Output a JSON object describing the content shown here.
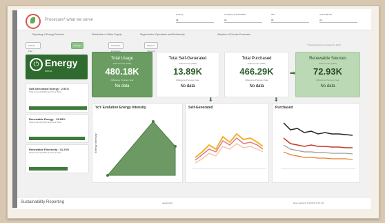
{
  "tagline": "Prosecure* what we serve",
  "filters": [
    {
      "label": "Country",
      "value": "All"
    },
    {
      "label": "Company & Asset Base",
      "value": "All"
    },
    {
      "label": "Site",
      "value": "All"
    },
    {
      "label": "Year & Month",
      "value": "All"
    }
  ],
  "nav_tabs": [
    "Reporting of Energy Emission",
    "Distribution of Water Supply",
    "Regeneration Operations and Biodiversity",
    "Adoption of Circular Processes"
  ],
  "buttons": [
    "CO2 & Fuel Emissions",
    "Energy",
    "GT Power Emissions",
    "Scope 3 Inventory Tool"
  ],
  "hint": "* Selected figures compared to 2020",
  "energy": {
    "title": "Energy",
    "subtitle": "KWh 01"
  },
  "side_cards": [
    {
      "title": "Self-Generated Energy · 2.91%",
      "sub": "Total Amount (KWh) and % of Total",
      "bar_fill": 0.92
    },
    {
      "title": "Renewable Energy · 15.18%",
      "sub": "Total Amount (KWh) and % of Total",
      "bar_fill": 0.88
    },
    {
      "title": "Renewable Electricity · 41.23%",
      "sub": "Total Amount (KWh) and % of Total",
      "bar_fill": 0.6
    }
  ],
  "kpis": [
    {
      "title": "Total Usage",
      "sub": "Total Amount (KWh)",
      "value": "480.18K",
      "note": "Difference Previous Year",
      "delta": "No data"
    },
    {
      "title": "Total Self-Generated",
      "sub": "Total Amount (KWh)",
      "value": "13.89K",
      "note": "Difference Previous Year",
      "delta": "No data"
    },
    {
      "title": "Total Purchased",
      "sub": "Total Amount (KWh)",
      "value": "466.29K",
      "note": "Difference Previous Year",
      "delta": "No data"
    },
    {
      "title": "Renewable Sources",
      "sub": "Total Amount (KWh)",
      "value": "72.93K",
      "note": "Difference Previous Year",
      "delta": "No data"
    }
  ],
  "charts": {
    "evolution": {
      "title": "YoY Evolution Energy Intensity",
      "ylabel": "Energy Intensity"
    },
    "self_generated": {
      "title": "Self-Generated"
    },
    "purchased": {
      "title": "Purchased"
    }
  },
  "footer": {
    "left": "Sustainability Reporting",
    "center": "powered by",
    "right": "Data updated: 3/3/2025 11:51 AM"
  }
}
